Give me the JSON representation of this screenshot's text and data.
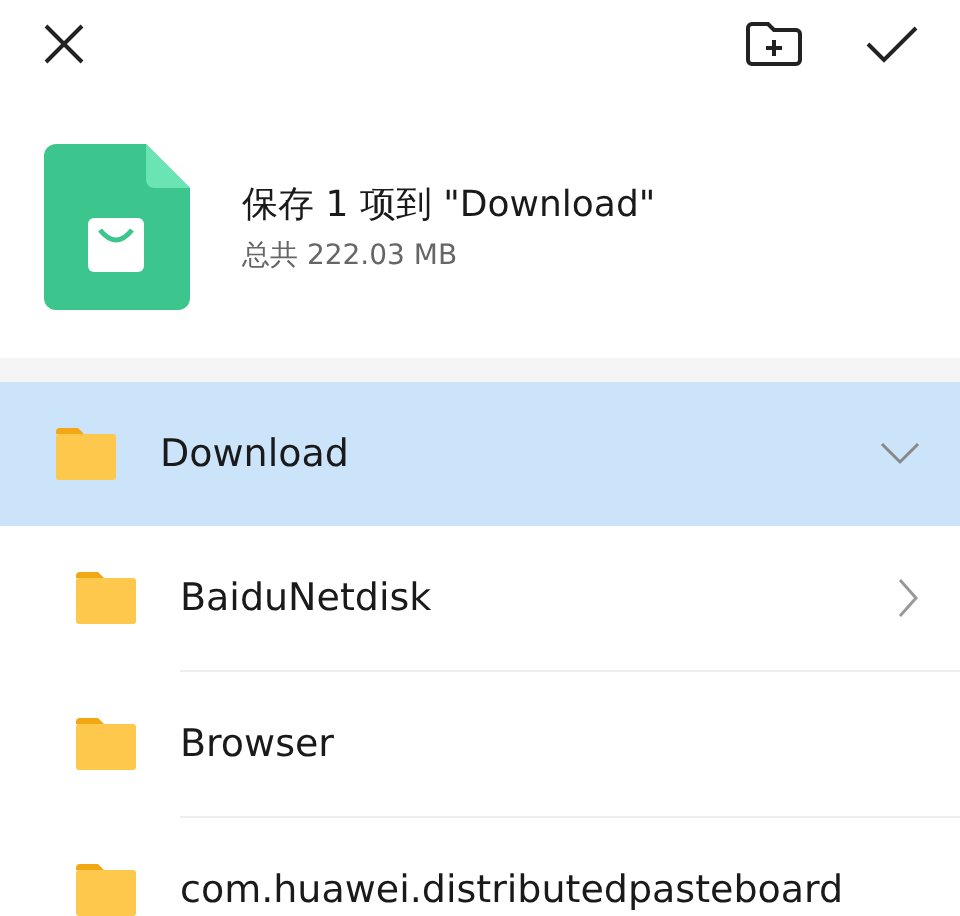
{
  "header": {
    "title": "保存 1 项到 \"Download\"",
    "subtitle": "总共 222.03 MB"
  },
  "folder": {
    "name": "Download",
    "selected": true,
    "expanded": true,
    "children": [
      {
        "name": "BaiduNetdisk",
        "chevron": true
      },
      {
        "name": "Browser",
        "chevron": false
      },
      {
        "name": "com.huawei.distributedpasteboard",
        "chevron": false
      }
    ]
  }
}
